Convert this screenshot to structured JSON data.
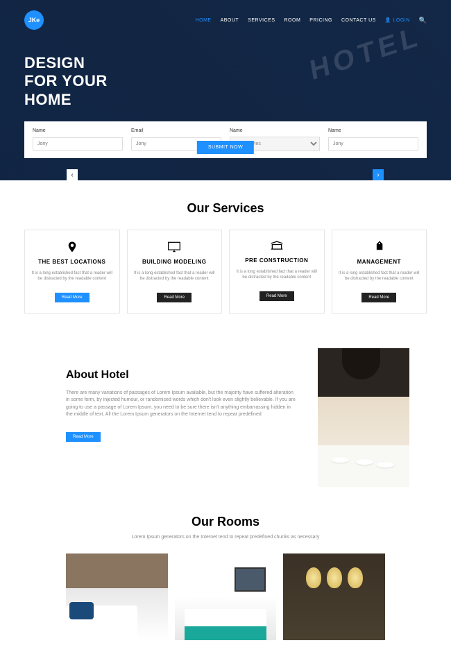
{
  "logo": "JKe",
  "nav": {
    "home": "HOME",
    "about": "ABOUT",
    "services": "SERVICES",
    "room": "ROOM",
    "pricing": "PRICING",
    "contact": "CONTACT US",
    "login": "LOGIN"
  },
  "hero": {
    "title_l1": "DESIGN",
    "title_l2": "FOR YOUR",
    "title_l3": "HOME",
    "bg_text": "HOTEL"
  },
  "form": {
    "f1": {
      "label": "Name",
      "ph": "Jony"
    },
    "f2": {
      "label": "Email",
      "ph": "Jony"
    },
    "f3": {
      "label": "Name",
      "sel": "Hair Styles"
    },
    "f4": {
      "label": "Name",
      "ph": "Jony"
    },
    "submit": "SUBMIT NOW"
  },
  "services": {
    "title": "Our Services",
    "desc": "It is a long established fact that a reader will be distracted by the readable content",
    "read_more": "Read More",
    "items": [
      {
        "title": "THE BEST LOCATIONS"
      },
      {
        "title": "BUILDING MODELING"
      },
      {
        "title": "PRE CONSTRUCTION"
      },
      {
        "title": "MANAGEMENT"
      }
    ]
  },
  "about": {
    "title": "About Hotel",
    "body": "There are many variations of passages of Lorem Ipsum available, but the majority have suffered alteration in some form, by injected humour, or randomised words which don't look even slightly believable. If you are going to use a passage of Lorem Ipsum, you need to be sure there isn't anything embarrassing hidden in the middle of text. All the Lorem Ipsum generators on the Internet tend to repeat predefined",
    "btn": "Read More"
  },
  "rooms": {
    "title": "Our Rooms",
    "sub": "Lorem Ipsum generators on the Internet tend to repeat predefined chunks as necessary"
  }
}
